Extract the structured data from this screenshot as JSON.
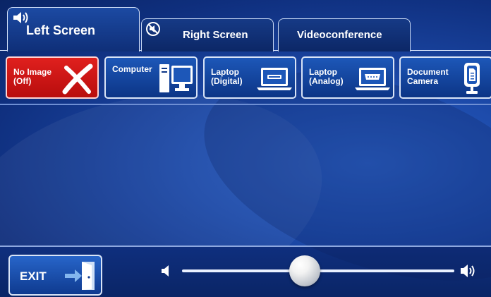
{
  "tabs": [
    {
      "label": "Left Screen",
      "active": true
    },
    {
      "label": "Right Screen",
      "active": false
    },
    {
      "label": "Videoconference",
      "active": false
    }
  ],
  "sources": [
    {
      "label": "No Image\n(Off)",
      "icon": "x-icon",
      "selected": true
    },
    {
      "label": "Computer",
      "icon": "computer-icon"
    },
    {
      "label": "Laptop\n(Digital)",
      "icon": "laptop-digital-icon"
    },
    {
      "label": "Laptop\n(Analog)",
      "icon": "laptop-analog-icon"
    },
    {
      "label": "Document\nCamera",
      "icon": "document-camera-icon"
    }
  ],
  "exit": {
    "label": "EXIT",
    "icon": "exit-door-icon"
  },
  "volume": {
    "level": 0.45
  },
  "colors": {
    "accent": "#1d57b8",
    "off": "#d41a18",
    "background": "#1c49a8"
  }
}
